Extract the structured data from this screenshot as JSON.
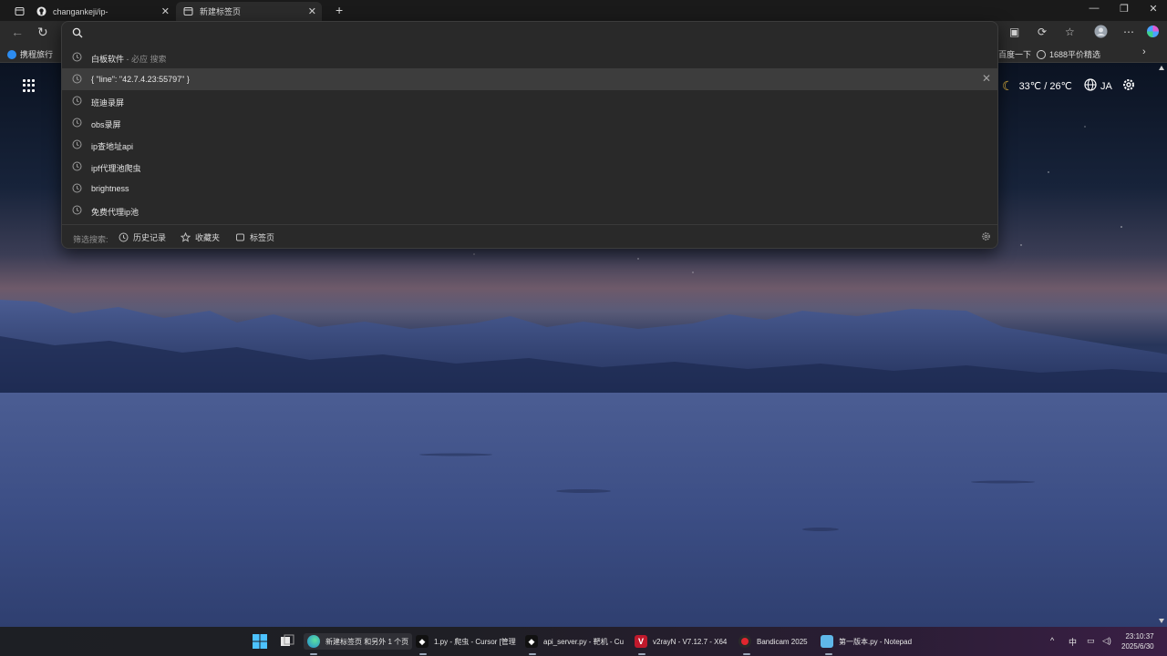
{
  "tabs": [
    {
      "title": "changankeji/ip-",
      "icon": "github-icon"
    },
    {
      "title": "新建标签页",
      "icon": "new-tab-icon"
    }
  ],
  "favorites": {
    "left": [
      {
        "label": "携程旅行"
      }
    ],
    "right": [
      {
        "label": "百度一下"
      },
      {
        "label": "1688平价精选"
      }
    ]
  },
  "omnibox": {
    "value": "",
    "suggestions": [
      {
        "text": "白板软件",
        "sub": " - 必应 搜索"
      },
      {
        "text": "{ \"line\": \"42.7.4.23:55797\" }",
        "sub": ""
      },
      {
        "text": "班迪录屏",
        "sub": ""
      },
      {
        "text": "obs录屏",
        "sub": ""
      },
      {
        "text": "ip查地址api",
        "sub": ""
      },
      {
        "text": "ipf代理池爬虫",
        "sub": ""
      },
      {
        "text": "brightness",
        "sub": ""
      },
      {
        "text": "免费代理ip池",
        "sub": ""
      }
    ],
    "footer": {
      "label": "筛选搜索:",
      "history": "历史记录",
      "favorites": "收藏夹",
      "tabs": "标签页"
    }
  },
  "newtab": {
    "weather": "33℃ / 26℃",
    "language": "JA"
  },
  "taskbar": {
    "items": [
      {
        "label": "新建标签页 和另外 1 个页"
      },
      {
        "label": "1.py - 爬虫 - Cursor [管理"
      },
      {
        "label": "api_server.py - 靶机 - Cu"
      },
      {
        "label": "v2rayN - V7.12.7 - X64"
      },
      {
        "label": "Bandicam 2025"
      },
      {
        "label": "第一版本.py - Notepad"
      }
    ],
    "ime": "中",
    "time": "23:10:37",
    "date": "2025/6/30"
  }
}
